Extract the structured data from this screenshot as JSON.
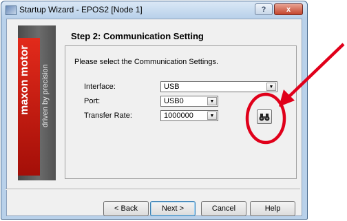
{
  "window": {
    "title": "Startup Wizard - EPOS2 [Node 1]",
    "help_glyph": "?",
    "close_glyph": "x"
  },
  "banner": {
    "brand": "maxon motor",
    "tagline": "driven by precision"
  },
  "wizard": {
    "step_title": "Step 2: Communication Setting",
    "instruction": "Please select the Communication Settings.",
    "fields": {
      "interface": {
        "label": "Interface:",
        "value": "USB"
      },
      "port": {
        "label": "Port:",
        "value": "USB0"
      },
      "transfer_rate": {
        "label": "Transfer Rate:",
        "value": "1000000"
      }
    },
    "search_button_icon": "binoculars-icon"
  },
  "buttons": {
    "back": "< Back",
    "next": "Next >",
    "cancel": "Cancel",
    "help": "Help"
  },
  "annotation": {
    "color": "#e0001a"
  }
}
